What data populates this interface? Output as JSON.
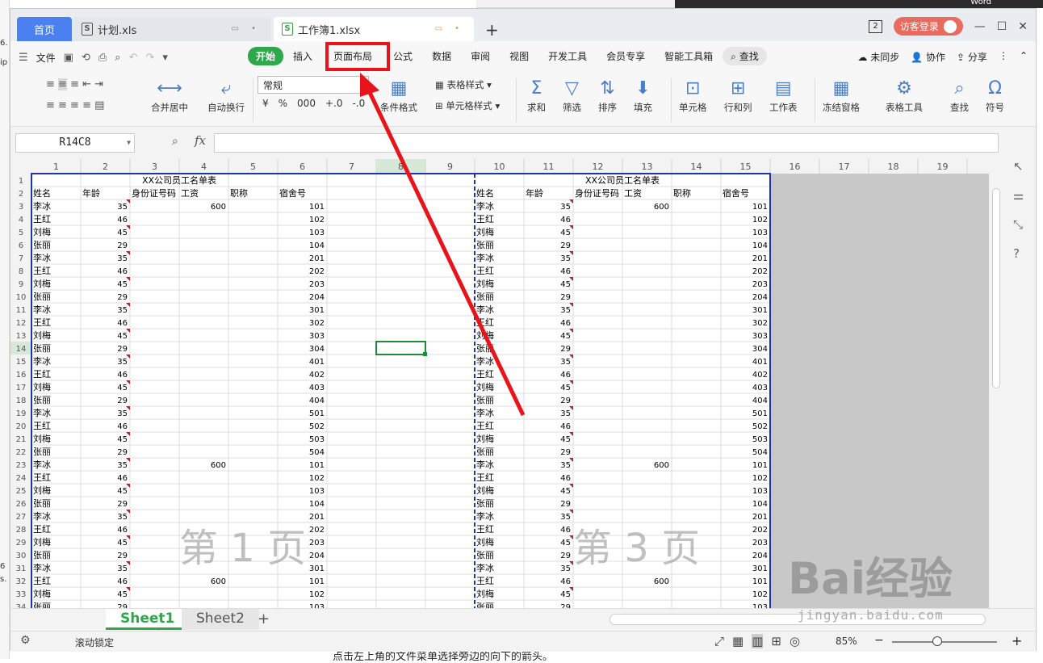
{
  "backdrop": {
    "left_text": [
      "6.",
      "ip",
      "6",
      "s."
    ],
    "top_right_text": "Word",
    "bottom_text": "点击左上角的文件菜单选择旁边的向下的箭头。"
  },
  "tabs": {
    "home": "首页",
    "file1": "计划.xls",
    "file2": "工作簿1.xlsx",
    "add": "+"
  },
  "titlebar": {
    "window_count": "2",
    "login": "访客登录",
    "min": "—",
    "max": "☐",
    "close": "✕"
  },
  "menu": {
    "file": "文件",
    "tabs": [
      "开始",
      "插入",
      "页面布局",
      "公式",
      "数据",
      "审阅",
      "视图",
      "开发工具",
      "会员专享",
      "智能工具箱"
    ],
    "search": "查找",
    "sync": "未同步",
    "collab": "协作",
    "share": "分享"
  },
  "ribbon": {
    "merge": "合并居中",
    "wrap": "自动换行",
    "format": "常规",
    "cond": "条件格式",
    "tablestyle": "表格样式",
    "cellstyle": "单元格样式",
    "sum": "求和",
    "filter": "筛选",
    "sort": "排序",
    "fill": "填充",
    "cell": "单元格",
    "rowcol": "行和列",
    "sheet": "工作表",
    "freeze": "冻结窗格",
    "tabletools": "表格工具",
    "find": "查找",
    "symbol": "符号",
    "percent": "%",
    "thousand": "000",
    "dec_add": "+.0",
    "dec_sub": "-.0",
    "currency": "¥"
  },
  "formula": {
    "cell_ref": "R14C8",
    "fx": "fx"
  },
  "grid": {
    "cols": [
      "1",
      "2",
      "3",
      "4",
      "5",
      "6",
      "7",
      "8",
      "9",
      "10",
      "11",
      "12",
      "13",
      "14",
      "15",
      "16",
      "17",
      "18",
      "19"
    ],
    "title": "XX公司员工名单表",
    "headers": [
      "姓名",
      "年龄",
      "身份证号码",
      "工资",
      "职称",
      "宿舍号"
    ],
    "names": [
      "李冰",
      "王红",
      "刘梅",
      "张丽"
    ],
    "ages": [
      "35",
      "46",
      "45",
      "29"
    ],
    "rooms": [
      "101",
      "102",
      "103",
      "104",
      "201",
      "202",
      "203",
      "204",
      "301",
      "302",
      "303",
      "304",
      "401",
      "402",
      "403",
      "404",
      "501",
      "502",
      "503",
      "504",
      "101",
      "102",
      "103",
      "104",
      "201",
      "202",
      "203",
      "204",
      "301",
      "101",
      "102",
      "103"
    ],
    "salary": "600",
    "page1": "第 1 页",
    "page3": "第 3 页"
  },
  "sheets": {
    "s1": "Sheet1",
    "s2": "Sheet2",
    "add": "+"
  },
  "status": {
    "lock": "滚动锁定",
    "zoom": "85%",
    "minus": "−",
    "plus": "+"
  },
  "watermark": {
    "brand": "Bai经验",
    "url": "jingyan.baidu.com"
  }
}
